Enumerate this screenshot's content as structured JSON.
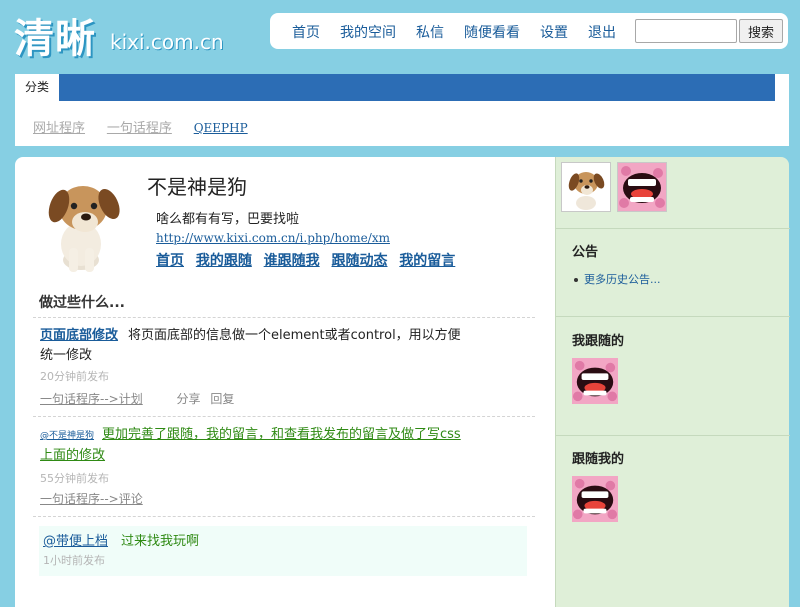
{
  "header": {
    "logo_cn": "清晰",
    "logo_en": "kixi.com.cn",
    "nav": [
      "首页",
      "我的空间",
      "私信",
      "随便看看",
      "设置",
      "退出"
    ],
    "search_placeholder": "",
    "search_button": "搜索"
  },
  "categories": {
    "tab_label": "分类",
    "links": [
      "网址程序",
      "一句话程序",
      "QEEPHP"
    ]
  },
  "profile": {
    "name": "不是神是狗",
    "bio": "啥么都有有写，巴要找啦",
    "url": "http://www.kixi.com.cn/i.php/home/xm",
    "nav": [
      "首页",
      "我的跟随",
      "谁跟随我",
      "跟随动态",
      "我的留言"
    ]
  },
  "feed": {
    "section_title": "做过些什么...",
    "items": [
      {
        "title": "页面底部修改",
        "text": "将页面底部的信息做一个element或者control，用以方便统一修改",
        "time": "20分钟前发布",
        "source": "一句话程序-->计划",
        "share": "分享",
        "reply": "回复"
      },
      {
        "mention": "@不是神是狗",
        "text": "更加完善了跟随，我的留言，和查看我发布的留言及做了写css上面的修改",
        "time": "55分钟前发布",
        "source": "一句话程序-->评论"
      },
      {
        "mention": "@带便上档",
        "text": "过来找我玩啊",
        "time": "1小时前发布"
      }
    ]
  },
  "sidebar": {
    "announcement_title": "公告",
    "announcement_link": "更多历史公告...",
    "following_title": "我跟随的",
    "followers_title": "跟随我的"
  },
  "colors": {
    "page_bg": "#86cfe3",
    "nav_link": "#1a5c9a",
    "category_strip": "#2c6db5",
    "sidebar_bg": "#dfefd8",
    "green_text": "#2f8a14"
  },
  "icons": {
    "profile_photo": "puppy-avatar",
    "thumb_1": "puppy-avatar",
    "thumb_2": "laughing-mouth-avatar"
  }
}
